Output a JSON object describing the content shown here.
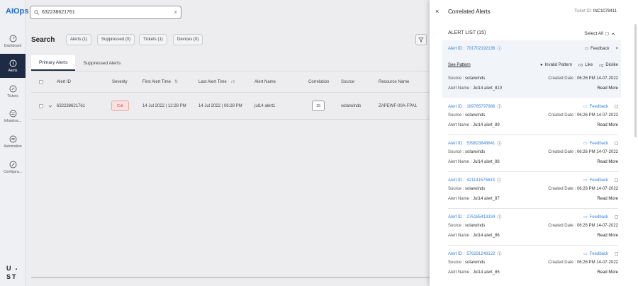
{
  "app": {
    "brand": "AIOps"
  },
  "search": {
    "value": "632238621761",
    "placeholder": ""
  },
  "nav": {
    "items": [
      {
        "label": "Dashboard"
      },
      {
        "label": "Alerts"
      },
      {
        "label": "Tickets"
      },
      {
        "label": "Infrastruc..."
      },
      {
        "label": "Automation"
      },
      {
        "label": "Configura..."
      }
    ],
    "logo": [
      "U",
      "S",
      "T"
    ]
  },
  "main": {
    "title": "Search",
    "chips": [
      "Alerts (1)",
      "Suppressed (0)",
      "Tickets (1)",
      "Devices (0)"
    ],
    "tabs": [
      "Primary Alerts",
      "Suppressed Alerts"
    ],
    "columns": [
      "Alert ID",
      "Severity",
      "First Alert Time",
      "Last Alert Time",
      "Alert Name",
      "Correlation",
      "Source",
      "Resource Name"
    ],
    "rows": [
      {
        "alert_id": "632238621761",
        "severity": "Crit",
        "first_time": "14 Jul 2022 | 12:28 PM",
        "last_time": "14 Jul 2022 | 06:28 PM",
        "alert_name": "jul14 alert1",
        "correlation": "15",
        "source": "solarwinds",
        "resource": "ZAPEWF-00A-FPA1"
      }
    ]
  },
  "panel": {
    "title": "Correlated Alerts",
    "ticket_label": "Ticket ID:",
    "ticket_id": "INC1078411",
    "list_header": "ALERT LIST (15)",
    "select_all": "Select All",
    "labels": {
      "alert_id": "Alert ID :",
      "source": "Source :",
      "alert_name": "Alert Name :",
      "created": "Created Date :",
      "read_more": "Read More",
      "feedback": "Feedback",
      "see_pattern": "See Pattern",
      "invalid_pattern": "Invalid Pattern",
      "like": "Like",
      "dislike": "Dislike"
    },
    "alerts": [
      {
        "id": "701702192136",
        "source": "solarwinds",
        "name": "Jul14 alert_810",
        "created": "06:26 PM 14-07-2022"
      },
      {
        "id": "169785797986",
        "source": "solarwinds",
        "name": "Jul14 alert_89",
        "created": "06:26 PM 14-07-2022"
      },
      {
        "id": "539823848841",
        "source": "solarwinds",
        "name": "Jul14 alert_88",
        "created": "06:26 PM 14-07-2022"
      },
      {
        "id": "421141575633",
        "source": "solarwinds",
        "name": "Jul14 alert_87",
        "created": "06:26 PM 14-07-2022"
      },
      {
        "id": "276185413334",
        "source": "solarwinds",
        "name": "Jul14 alert_86",
        "created": "06:26 PM 14-07-2022"
      },
      {
        "id": "578291248122",
        "source": "solarwinds",
        "name": "Jul14 alert_85",
        "created": "06:26 PM 14-07-2022"
      }
    ]
  },
  "colors": {
    "brand": "#1f6bd6",
    "nav_active": "#1f2b45",
    "link": "#3b82d6",
    "critical": "#c04a4a"
  }
}
